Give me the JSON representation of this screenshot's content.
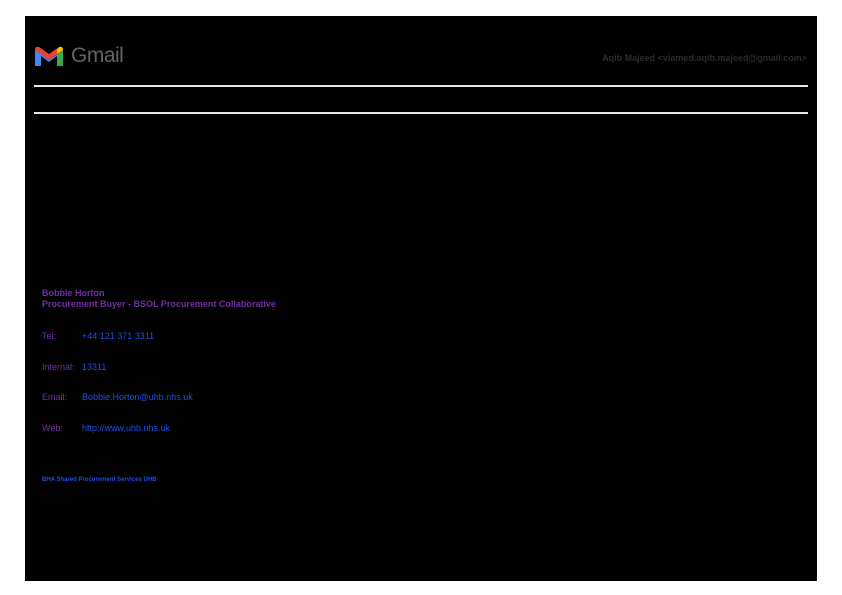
{
  "header": {
    "logo_text": "Gmail",
    "account": "Aqib Majeed <viamed.aqib.majeed@gmail.com>"
  },
  "signature": {
    "name": "Bobbie Horton",
    "role": "Procurement Buyer - BSOL Procurement Collaborative",
    "rows": [
      {
        "label": "Tel:",
        "value": "+44 121 371 3311"
      },
      {
        "label": "Internal:",
        "value": "13311"
      },
      {
        "label": "Email:",
        "value": "Bobbie.Horton@uhb.nhs.uk"
      },
      {
        "label": "Web:",
        "value": "http://www.uhb.nhs.uk"
      }
    ],
    "org": "BHA Shared Procurement Services UHB"
  },
  "colors": {
    "gmail_red": "#ea4335",
    "gmail_blue": "#4285f4",
    "gmail_green": "#34a853",
    "gmail_yellow": "#fbbc04",
    "signature_purple": "#7030a0",
    "signature_blue": "#1f4fe0"
  }
}
